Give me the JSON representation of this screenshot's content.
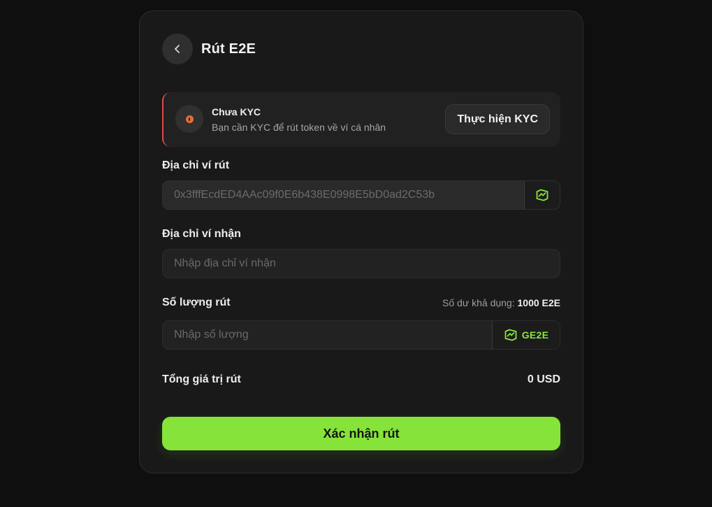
{
  "page": {
    "title": "Rút E2E"
  },
  "kyc": {
    "title": "Chưa KYC",
    "subtitle": "Bạn cần KYC để rút token về ví cá nhân",
    "button_label": "Thực hiện KYC",
    "accent_color": "#e24b4b",
    "icon": "alert-icon"
  },
  "from_wallet": {
    "label": "Địa chỉ ví rút",
    "value": "0x3fffEcdED4AAc09f0E6b438E0998E5bD0ad2C53b",
    "addon_icon": "e2e-logo-icon"
  },
  "to_wallet": {
    "label": "Địa chỉ ví nhận",
    "value": "",
    "placeholder": "Nhập địa chỉ ví nhận"
  },
  "amount": {
    "label": "Số lượng rút",
    "balance_label": "Số dư khả dụng:",
    "balance_value": "1000 E2E",
    "value": "",
    "placeholder": "Nhập số lượng",
    "token_label": "GE2E",
    "token_icon": "e2e-logo-icon"
  },
  "total": {
    "label": "Tổng giá trị rút",
    "value": "0 USD"
  },
  "confirm": {
    "label": "Xác nhận rút",
    "color": "#86e33a"
  }
}
